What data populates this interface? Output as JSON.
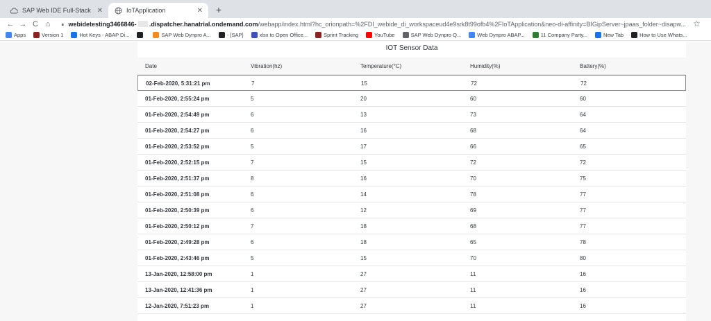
{
  "browser": {
    "tabs": [
      {
        "title": "SAP Web IDE Full-Stack",
        "icon": "cloud-icon",
        "active": false
      },
      {
        "title": "IoTApplication",
        "icon": "globe-icon",
        "active": true
      }
    ],
    "new_tab_label": "+",
    "address": {
      "host": "webidetesting3466846-",
      "domain": ".dispatcher.hanatrial.ondemand.com",
      "path": "/webapp/index.html?hc_orionpath=%2FDI_webide_di_workspaceud4e9srk8t99ofb4%2FIoTApplication&neo-di-affinity=BIGipServer~jpaas_folder~disapw..."
    },
    "nav": {
      "back": "←",
      "forward": "→",
      "reload": "C",
      "home": "⌂",
      "star": "☆"
    }
  },
  "bookmarks": [
    {
      "label": "Apps",
      "color": "#4285f4"
    },
    {
      "label": "Version 1",
      "color": "#8b2323"
    },
    {
      "label": "Hot Keys - ABAP Di...",
      "color": "#1a73e8"
    },
    {
      "label": "",
      "color": "#202124"
    },
    {
      "label": "SAP Web Dynpro A...",
      "color": "#f28b20"
    },
    {
      "label": "- [SAP]",
      "color": "#202124"
    },
    {
      "label": "xlsx to Open Office...",
      "color": "#3f51b5"
    },
    {
      "label": "Sprint Tracking",
      "color": "#8b2323"
    },
    {
      "label": "YouTube",
      "color": "#ff0000"
    },
    {
      "label": "SAP Web Dynpro Q...",
      "color": "#5f6368"
    },
    {
      "label": "Web Dynpro ABAP...",
      "color": "#4285f4"
    },
    {
      "label": "11 Company Party...",
      "color": "#2e7d32"
    },
    {
      "label": "New Tab",
      "color": "#1a73e8"
    },
    {
      "label": "How to Use Whats...",
      "color": "#202124"
    }
  ],
  "page": {
    "title": "IOT Sensor Data",
    "columns": [
      "Date",
      "Vibration(hz)",
      "Temperature(°C)",
      "Humidity(%)",
      "Battery(%)"
    ],
    "rows": [
      [
        "02-Feb-2020, 5:31:21 pm",
        "7",
        "15",
        "72",
        "72"
      ],
      [
        "01-Feb-2020, 2:55:24 pm",
        "5",
        "20",
        "60",
        "60"
      ],
      [
        "01-Feb-2020, 2:54:49 pm",
        "6",
        "13",
        "73",
        "64"
      ],
      [
        "01-Feb-2020, 2:54:27 pm",
        "6",
        "16",
        "68",
        "64"
      ],
      [
        "01-Feb-2020, 2:53:52 pm",
        "5",
        "17",
        "66",
        "65"
      ],
      [
        "01-Feb-2020, 2:52:15 pm",
        "7",
        "15",
        "72",
        "72"
      ],
      [
        "01-Feb-2020, 2:51:37 pm",
        "8",
        "16",
        "70",
        "75"
      ],
      [
        "01-Feb-2020, 2:51:08 pm",
        "6",
        "14",
        "78",
        "77"
      ],
      [
        "01-Feb-2020, 2:50:39 pm",
        "6",
        "12",
        "69",
        "77"
      ],
      [
        "01-Feb-2020, 2:50:12 pm",
        "7",
        "18",
        "68",
        "77"
      ],
      [
        "01-Feb-2020, 2:49:28 pm",
        "6",
        "18",
        "65",
        "78"
      ],
      [
        "01-Feb-2020, 2:43:46 pm",
        "5",
        "15",
        "70",
        "80"
      ],
      [
        "13-Jan-2020, 12:58:00 pm",
        "1",
        "27",
        "11",
        "16"
      ],
      [
        "13-Jan-2020, 12:41:36 pm",
        "1",
        "27",
        "11",
        "16"
      ],
      [
        "12-Jan-2020, 7:51:23 pm",
        "1",
        "27",
        "11",
        "16"
      ]
    ],
    "selected_row": 0
  }
}
